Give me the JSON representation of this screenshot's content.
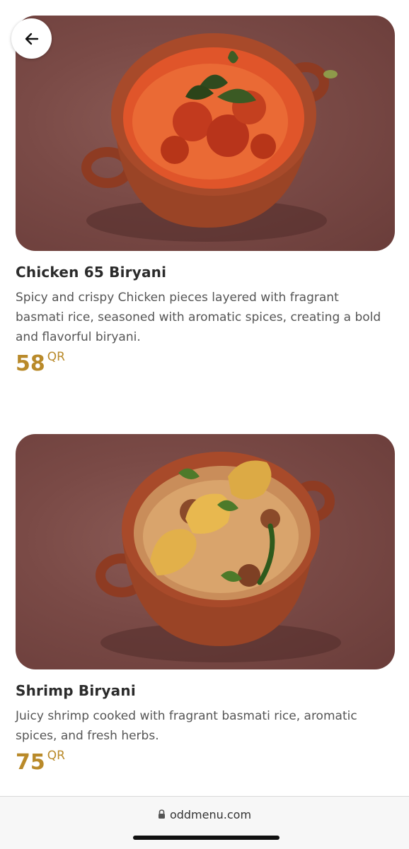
{
  "items": [
    {
      "title": "Chicken 65 Biryani",
      "description": "Spicy and crispy Chicken pieces layered with fragrant basmati rice, seasoned with aromatic spices, creating a bold and flavorful biryani.",
      "price": "58",
      "currency": "QR"
    },
    {
      "title": "Shrimp Biryani",
      "description": "Juicy shrimp cooked with fragrant basmati rice, aromatic spices, and fresh herbs.",
      "price": "75",
      "currency": "QR"
    }
  ],
  "browser": {
    "url": "oddmenu.com"
  },
  "icons": {
    "back": "arrow-left-icon",
    "lock": "lock-icon"
  },
  "colors": {
    "price": "#b98a2a",
    "background": "#ffffff"
  }
}
